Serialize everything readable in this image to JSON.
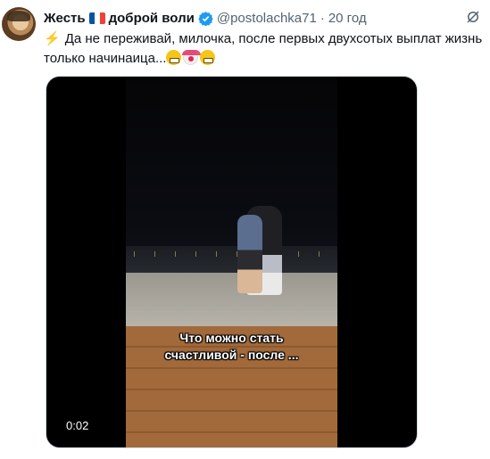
{
  "tweet": {
    "display_name_part1": "Жесть",
    "display_name_part2": "доброй воли",
    "handle": "@postolachka71",
    "separator": "·",
    "time": "20 год",
    "text_line1": "Да не переживай, милочка, после первых двухсотых выплат жизнь",
    "text_line2": "только начинаица...",
    "icons": {
      "avatar": "user-avatar",
      "flag": "france-flag-icon",
      "verified": "verified-badge-icon",
      "bolt": "lightning-bolt-icon",
      "emoji_1": "grimacing-face-emoji",
      "emoji_2": "clown-face-emoji",
      "emoji_3": "grimacing-face-emoji",
      "grok": "grok-icon"
    },
    "colors": {
      "verified": "#1d9bf0",
      "secondary_text": "#536471",
      "flag": [
        "#0055a4",
        "#ffffff",
        "#ef4135"
      ]
    }
  },
  "video": {
    "caption_line1": "Что можно стать",
    "caption_line2": "счастливой - после ...",
    "timecode": "0:02"
  }
}
